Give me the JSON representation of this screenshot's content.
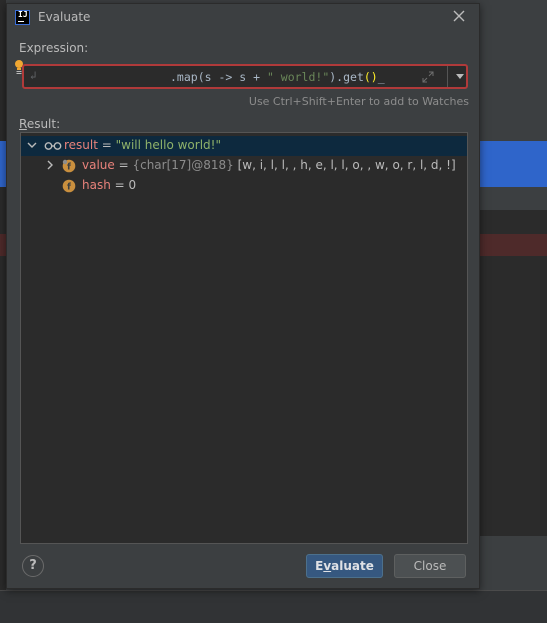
{
  "window": {
    "title": "Evaluate",
    "app_icon_text": "IJ"
  },
  "expression": {
    "label": "Expression:",
    "code_plain_1": ".map(s -> s + ",
    "code_string": "\" world!\"",
    "code_plain_2": ").get",
    "code_parens": "()",
    "hint": "Use Ctrl+Shift+Enter to add to Watches"
  },
  "result": {
    "label_underlined": "R",
    "label_rest": "esult:",
    "rows": [
      {
        "name": "result",
        "eq": " = ",
        "value": "\"will hello world!\""
      },
      {
        "name": "value",
        "eq": " = ",
        "type": "{char[17]@818}",
        "value": " [w, i, l, l,  , h, e, l, l, o,  , w, o, r, l, d, !]"
      },
      {
        "name": "hash",
        "eq": " = ",
        "value": "0"
      }
    ]
  },
  "buttons": {
    "help": "?",
    "evaluate_underlined": "v",
    "evaluate_pre": "E",
    "evaluate_post": "aluate",
    "close": "Close"
  },
  "colors": {
    "accent_blue": "#2f65ca",
    "error_border": "#b03a3a",
    "selection": "#0d293e",
    "string_green": "#6a8759"
  }
}
